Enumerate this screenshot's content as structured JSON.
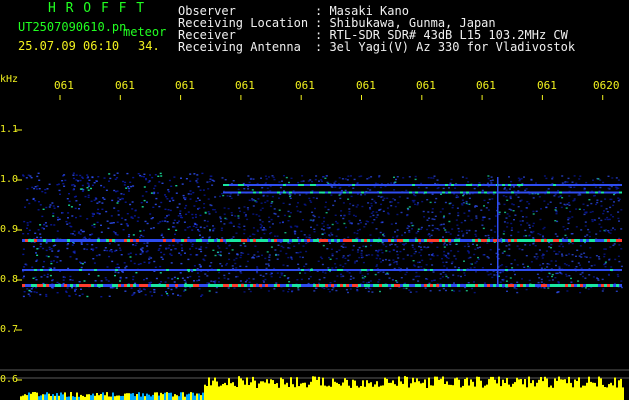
{
  "header": {
    "title_logo": "H R O F F T",
    "file_id": "UT2507090610.pn",
    "file_sub": "meteor",
    "timestamp": "25.07.09 06:10",
    "frame_no": "34."
  },
  "info": {
    "observer_label": "Observer",
    "observer_value": ": Masaki Kano",
    "location_label": "Receiving Location",
    "location_value": ": Shibukawa, Gunma, Japan",
    "receiver_label": "Receiver",
    "receiver_value": ": RTL-SDR SDR# 43dB L15 103.2MHz CW",
    "antenna_label": "Receiving Antenna",
    "antenna_value": ": 3el Yagi(V) Az 330 for Vladivostok"
  },
  "axis": {
    "unit": "kHz",
    "x_ticks": [
      "061",
      "061",
      "061",
      "061",
      "061",
      "061",
      "061",
      "061",
      "061",
      "0620"
    ],
    "y_ticks": [
      "1.1",
      "1.0",
      "0.9",
      "0.8",
      "0.7",
      "0.6"
    ]
  },
  "chart_data": {
    "type": "heatmap",
    "title": "",
    "xlabel": "",
    "ylabel": "kHz",
    "x_ticks": [
      "061",
      "061",
      "061",
      "061",
      "061",
      "061",
      "061",
      "061",
      "061",
      "0620"
    ],
    "y_ticks": [
      1.1,
      1.0,
      0.9,
      0.8,
      0.7,
      0.6
    ],
    "ylim": [
      0.6,
      1.1
    ],
    "signal_lines_khz": [
      0.99,
      0.975,
      0.88,
      0.82,
      0.79
    ],
    "colors": {
      "background": "#000000",
      "noise_low": "#0a1aa0",
      "noise_mid": "#2e4df0",
      "signal_hi": "#19e6a0",
      "peak": "#ff3d2e",
      "amplitude_bar": "#ffff00",
      "amplitude_low": "#00aaff",
      "axis_text": "#f2f21e"
    }
  }
}
